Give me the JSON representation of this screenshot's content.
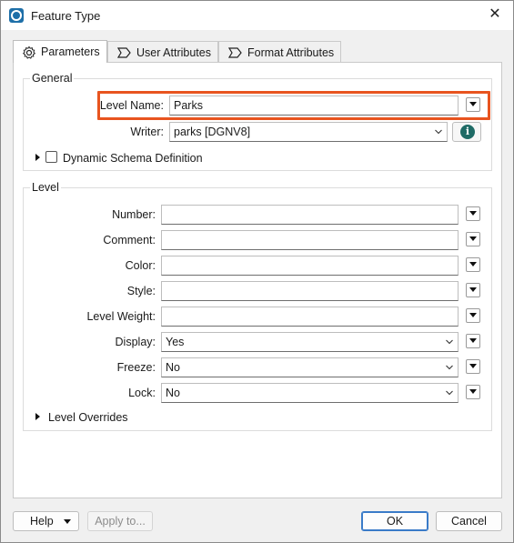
{
  "window": {
    "title": "Feature Type"
  },
  "tabs": [
    {
      "label": "Parameters",
      "icon": "gear-icon",
      "active": true
    },
    {
      "label": "User Attributes",
      "icon": "attribute-tag-icon",
      "active": false
    },
    {
      "label": "Format Attributes",
      "icon": "attribute-tag-icon",
      "active": false
    }
  ],
  "general": {
    "title": "General",
    "level_name": {
      "label": "Level Name:",
      "value": "Parks"
    },
    "writer": {
      "label": "Writer:",
      "value": "parks [DGNV8]"
    },
    "dynamic_schema": {
      "label": "Dynamic Schema Definition",
      "checked": false
    }
  },
  "level": {
    "title": "Level",
    "number": {
      "label": "Number:",
      "value": ""
    },
    "comment": {
      "label": "Comment:",
      "value": ""
    },
    "color": {
      "label": "Color:",
      "value": ""
    },
    "style": {
      "label": "Style:",
      "value": ""
    },
    "level_weight": {
      "label": "Level Weight:",
      "value": ""
    },
    "display": {
      "label": "Display:",
      "value": "Yes"
    },
    "freeze": {
      "label": "Freeze:",
      "value": "No"
    },
    "lock": {
      "label": "Lock:",
      "value": "No"
    },
    "overrides": {
      "label": "Level Overrides"
    }
  },
  "footer": {
    "help": "Help",
    "apply": "Apply to...",
    "ok": "OK",
    "cancel": "Cancel"
  },
  "colors": {
    "highlight": "#e8541f",
    "info": "#1f6b66",
    "default_button": "#3a7bc8"
  }
}
